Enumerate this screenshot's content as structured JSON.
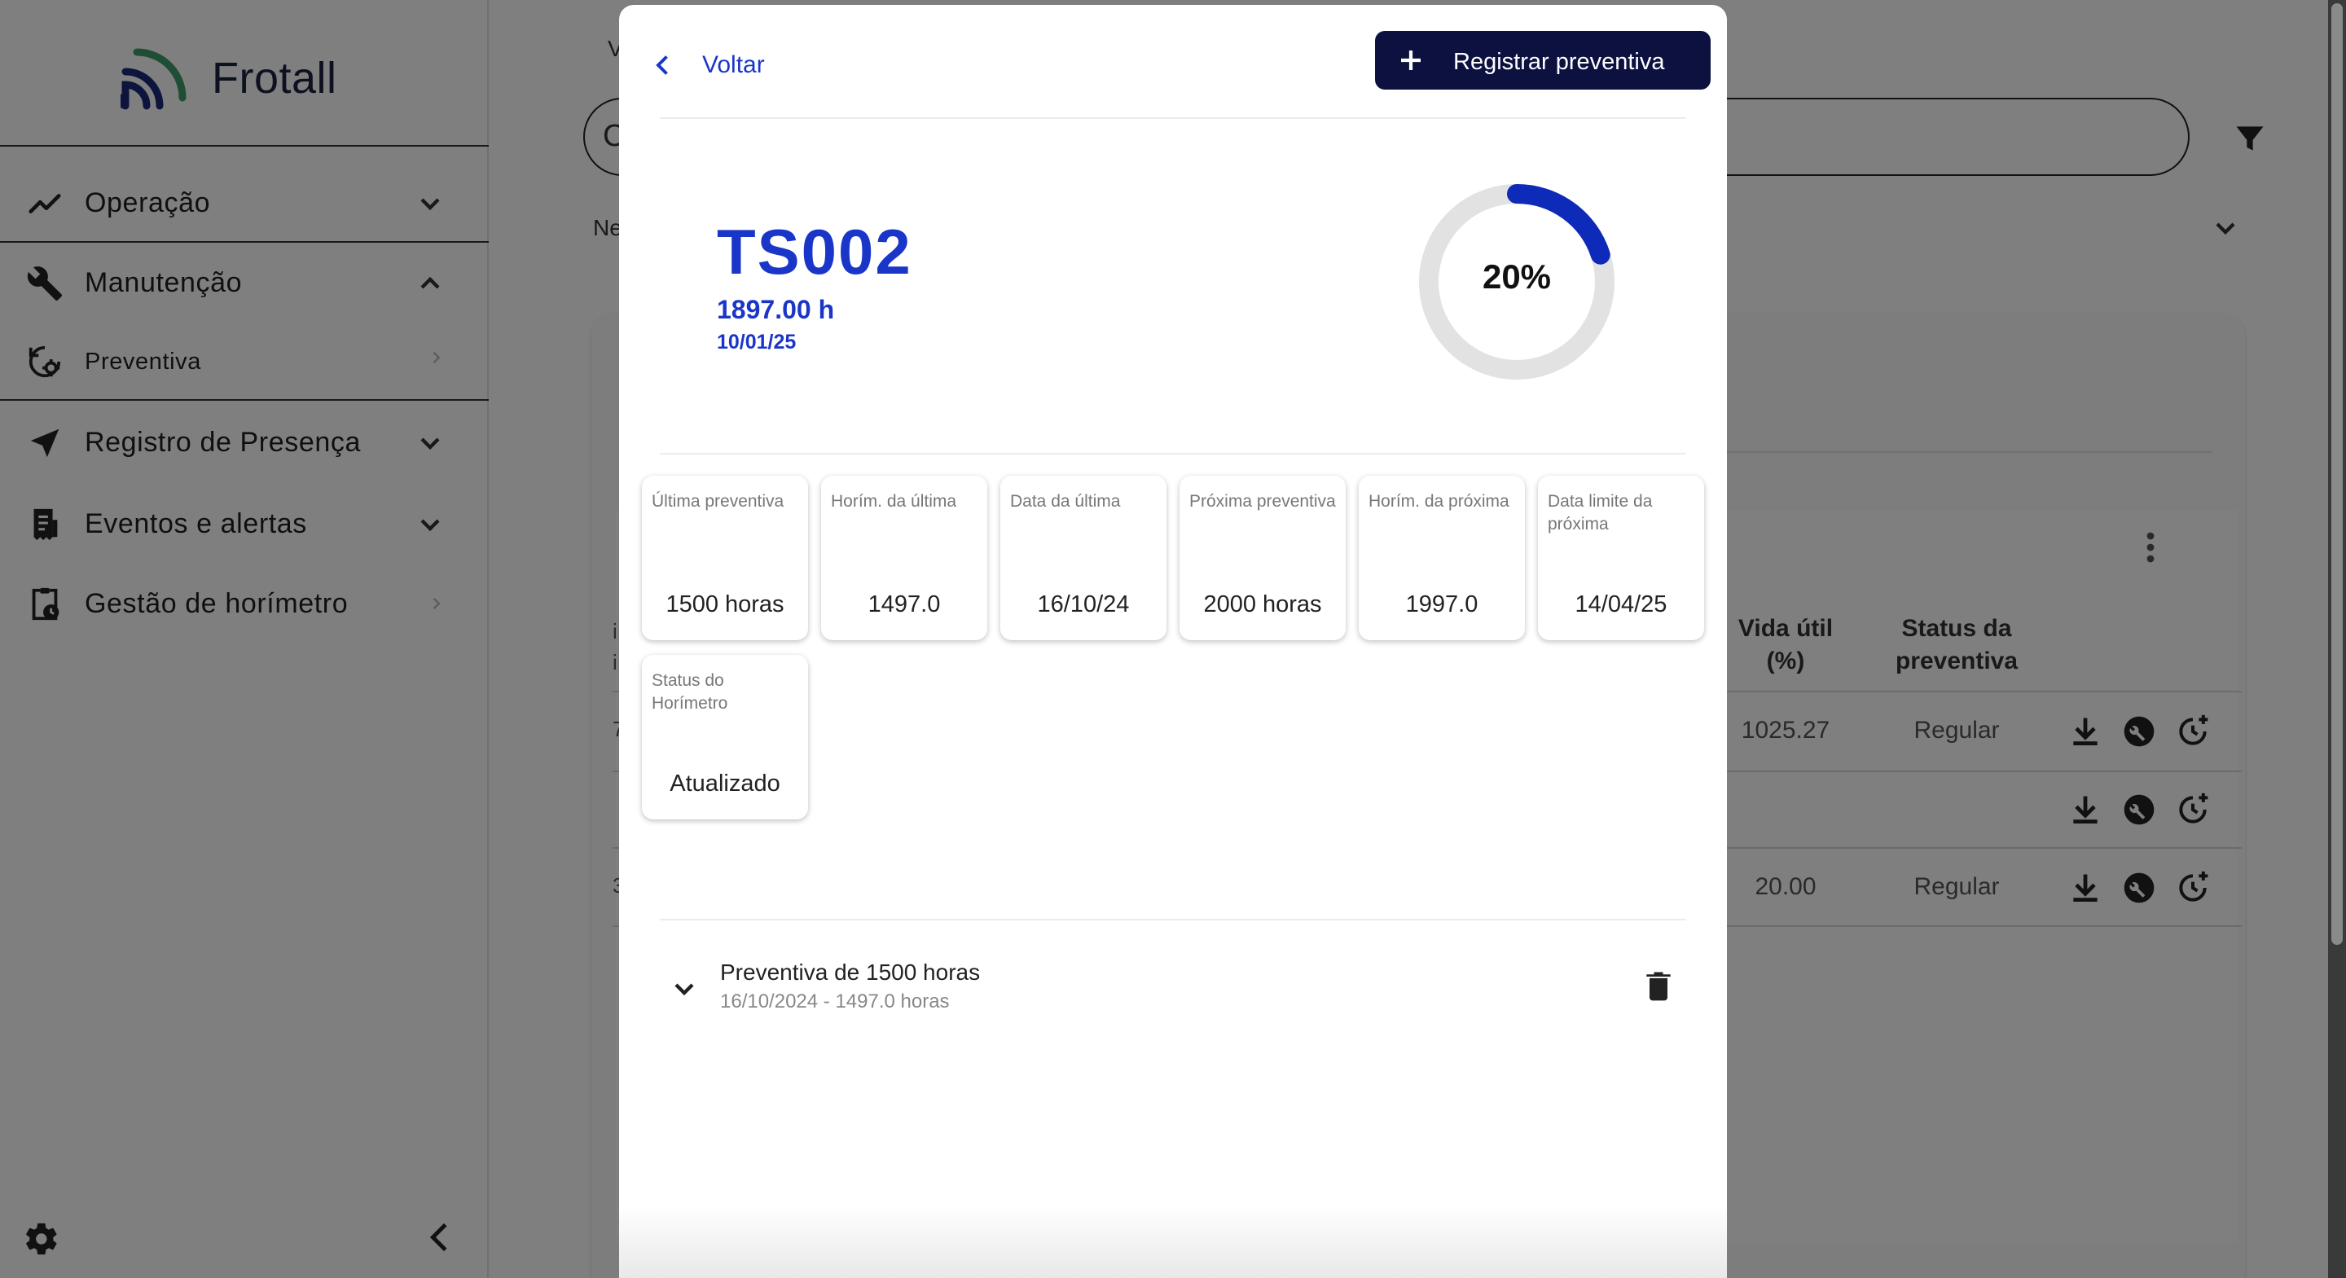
{
  "app": {
    "name": "Frotall"
  },
  "sidebar": {
    "items": [
      {
        "label": "Operação",
        "icon": "trending-up-icon"
      },
      {
        "label": "Manutenção",
        "icon": "wrench-icon"
      },
      {
        "label": "Preventiva",
        "icon": "history-gear-icon"
      },
      {
        "label": "Registro de Presença",
        "icon": "navigation-arrow-icon"
      },
      {
        "label": "Eventos e alertas",
        "icon": "receipt-icon"
      },
      {
        "label": "Gestão de horímetro",
        "icon": "clipboard-clock-icon"
      }
    ]
  },
  "main": {
    "crumb": "V",
    "search_fragment": "C",
    "select_fragment": "Ne",
    "table": {
      "headers": {
        "vida_util": "Vida útil (%)",
        "status": "Status da preventiva"
      },
      "rows": [
        {
          "left": "7",
          "vida_util": "1025.27",
          "status": "Regular"
        },
        {
          "left": "",
          "vida_util": "",
          "status": ""
        },
        {
          "left": "3",
          "vida_util": "20.00",
          "status": "Regular"
        }
      ],
      "left_header_fragment": "i",
      "left_header_fragment2": "i"
    }
  },
  "modal": {
    "back_label": "Voltar",
    "register_label": "Registrar preventiva",
    "asset": {
      "id": "TS002",
      "hours": "1897.00 h",
      "date": "10/01/25"
    },
    "progress": {
      "percent": 20,
      "label": "20%"
    },
    "stats": [
      {
        "title": "Última preventiva",
        "value": "1500 horas"
      },
      {
        "title": "Horím. da última",
        "value": "1497.0"
      },
      {
        "title": "Data da última",
        "value": "16/10/24"
      },
      {
        "title": "Próxima preventiva",
        "value": "2000 horas"
      },
      {
        "title": "Horím. da próxima",
        "value": "1997.0"
      },
      {
        "title": "Data limite da próxima",
        "value": "14/04/25"
      },
      {
        "title": "Status do Horímetro",
        "value": "Atualizado"
      }
    ],
    "history": [
      {
        "title": "Preventiva de 1500 horas",
        "subtitle": "16/10/2024 - 1497.0 horas"
      }
    ]
  },
  "colors": {
    "accent": "#1a36c8",
    "primary_dark": "#0c1140",
    "progress": "#0d2ab8",
    "track": "#e2e2e2"
  }
}
